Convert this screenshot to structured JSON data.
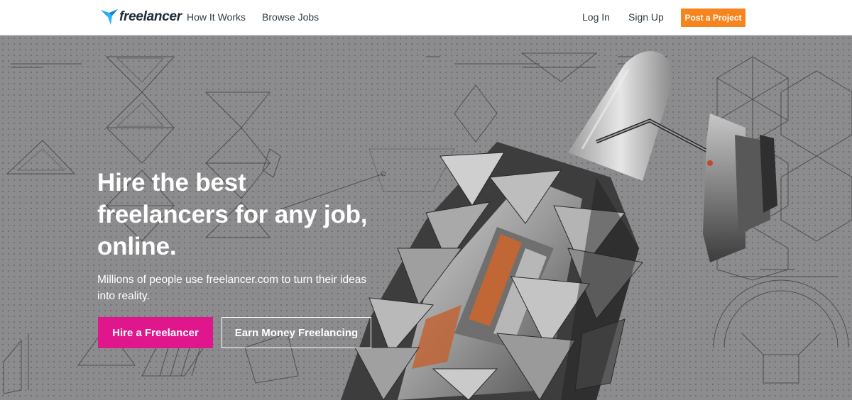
{
  "brand": {
    "logo_text": "freelancer",
    "logo_icon": "bird-icon",
    "accent": "#29b2fe"
  },
  "nav": {
    "links": [
      "How It Works",
      "Browse Jobs"
    ],
    "login": "Log In",
    "signup": "Sign Up",
    "post_project": "Post a Project",
    "post_project_color": "#f6851e"
  },
  "hero": {
    "headline_lines": [
      "Hire the best",
      "freelancers for any job,",
      "online."
    ],
    "subtext_lines": [
      "Millions of people use freelancer.com to turn their ideas",
      "into reality."
    ],
    "hire_button": "Hire a Freelancer",
    "hire_button_color": "#e0178c",
    "earn_button": "Earn Money Freelancing",
    "background_image": "spacecraft-blueprint"
  }
}
